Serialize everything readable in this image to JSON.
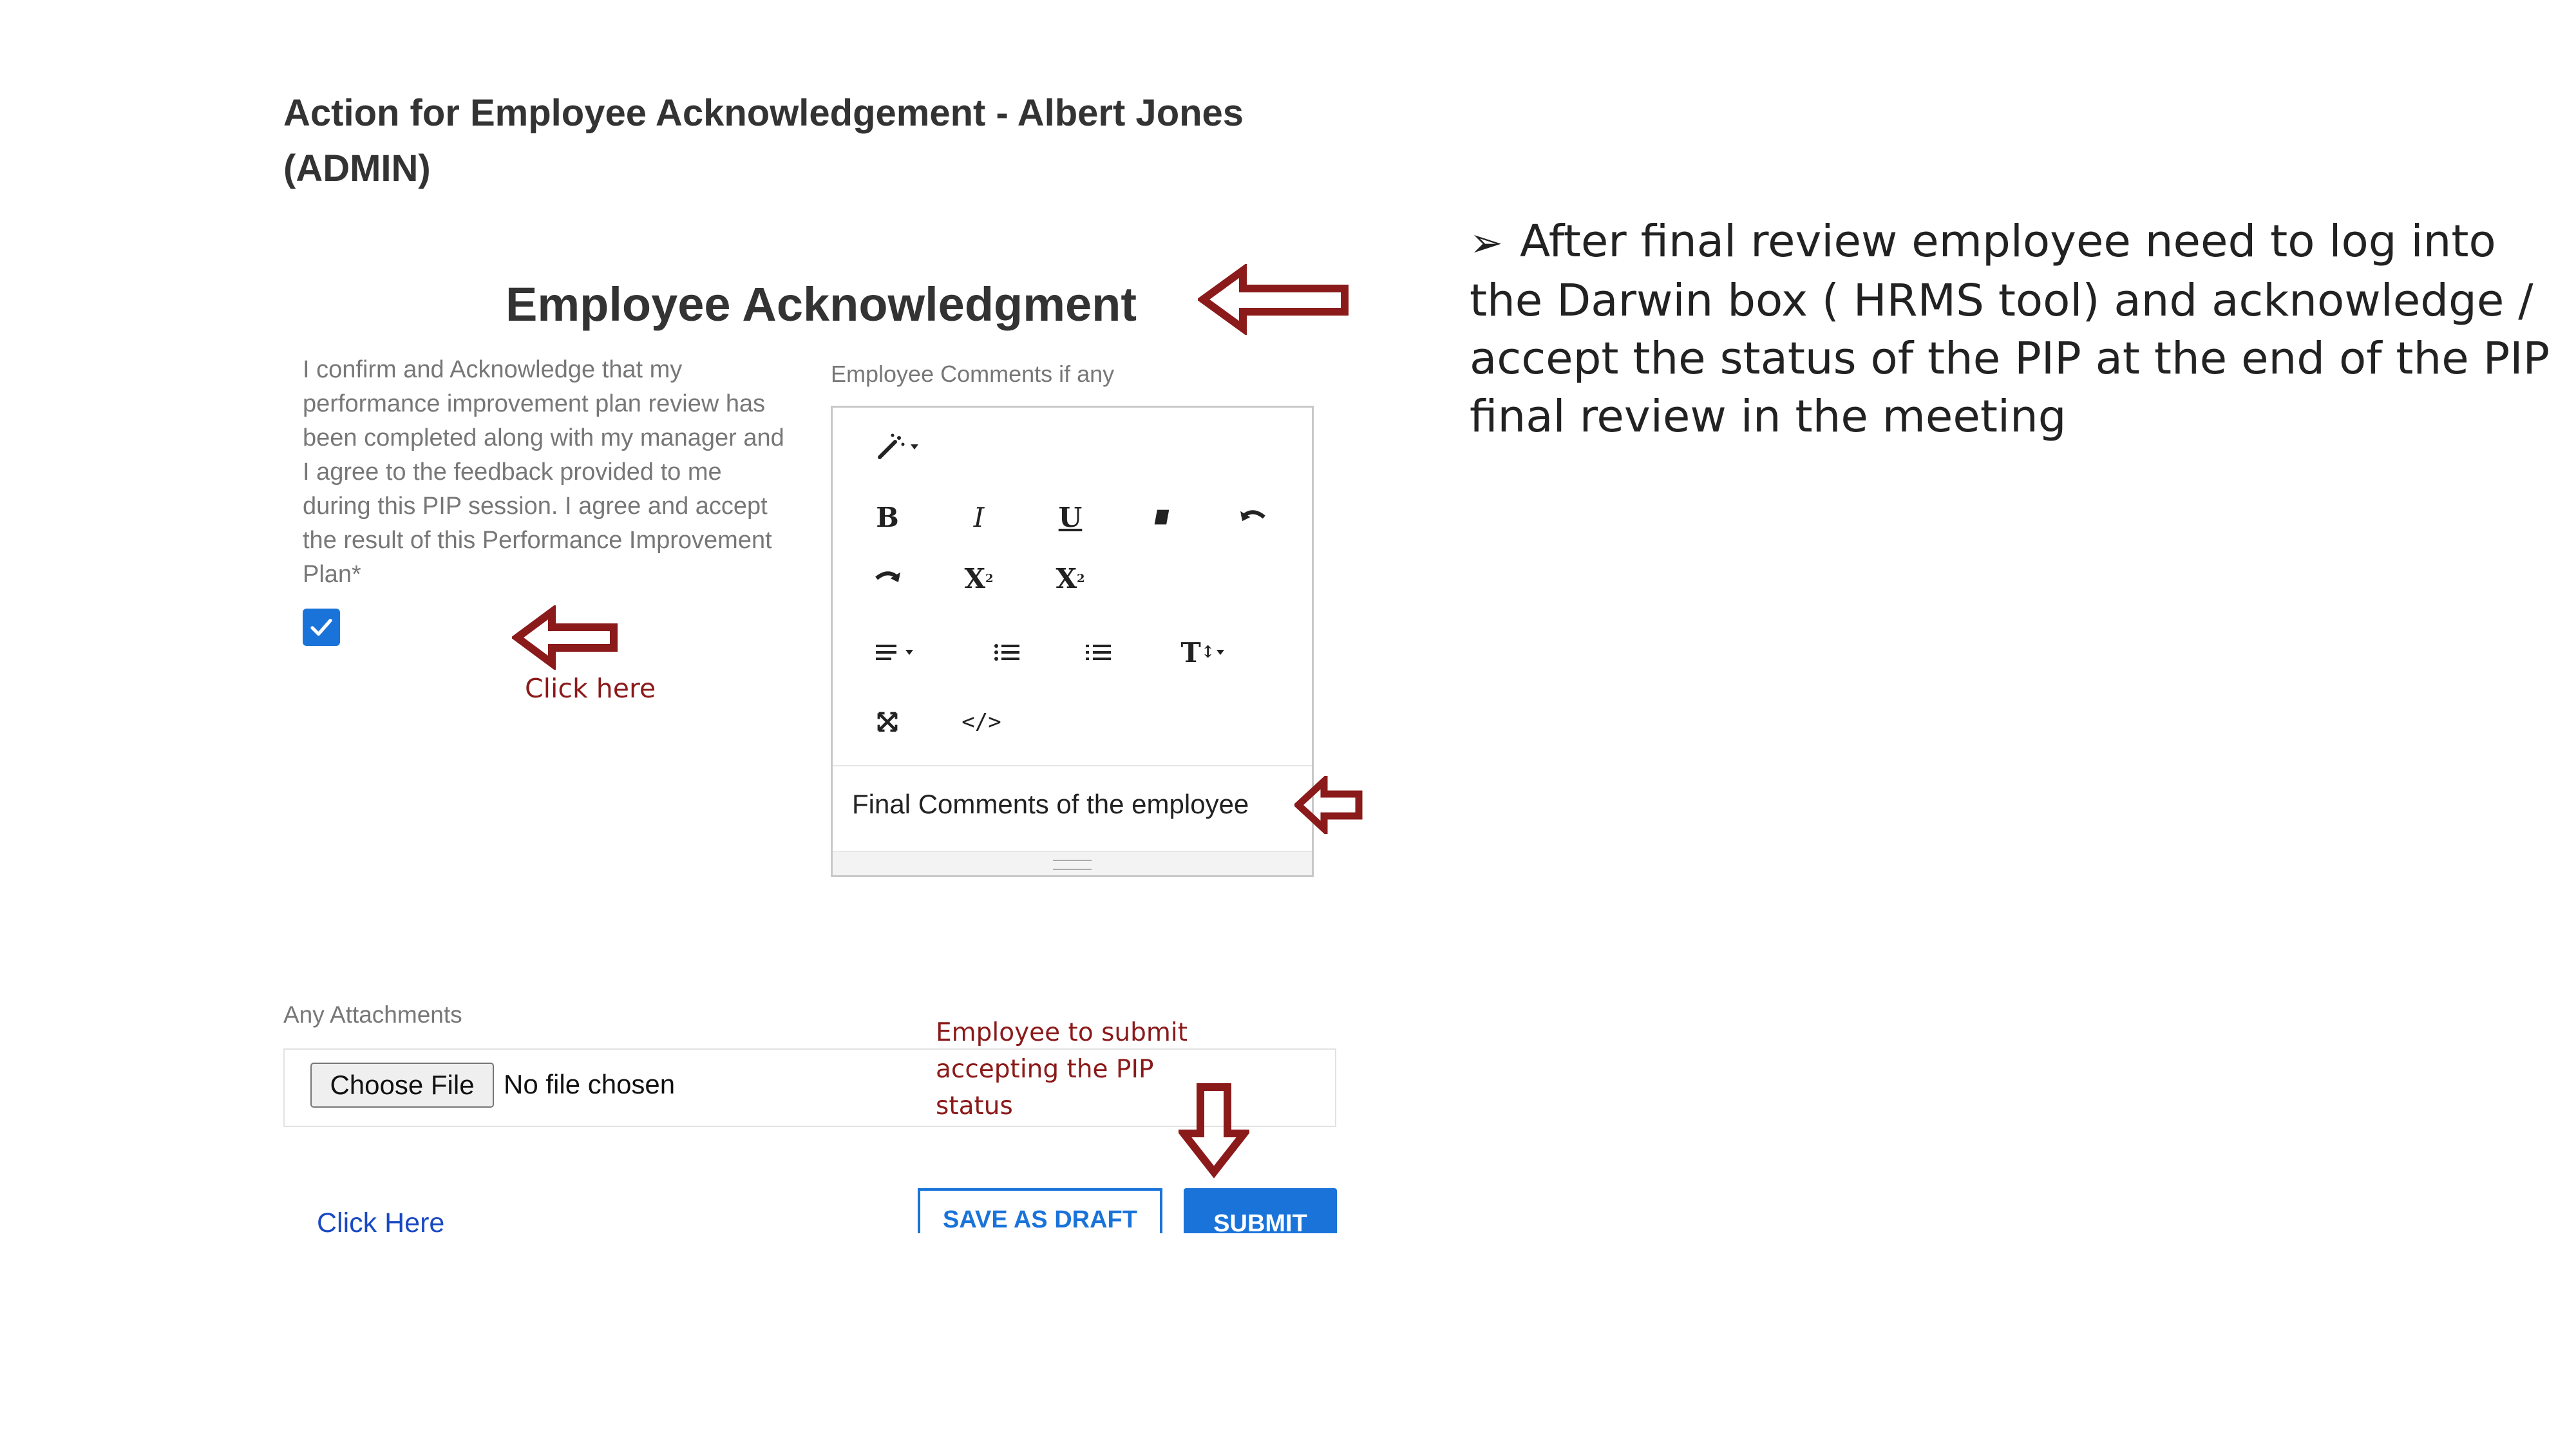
{
  "screenshot": {
    "page_title_line1": "Action for Employee Acknowledgement - Albert Jones",
    "page_title_line2": "(ADMIN)",
    "heading": "Employee Acknowledgment",
    "ack_text": "I confirm and Acknowledge that my performance improvement plan review has been completed along with my manager and I agree to the feedback provided to me during this PIP session. I agree and accept the result of this Performance Improvement Plan*",
    "ack_checked": true,
    "comments_label": "Employee Comments if any",
    "editor": {
      "toolbar": [
        {
          "name": "magic-wand-icon"
        },
        {
          "name": "bold-button",
          "glyph": "B"
        },
        {
          "name": "italic-button",
          "glyph": "I"
        },
        {
          "name": "underline-button",
          "glyph": "U"
        },
        {
          "name": "eraser-icon"
        },
        {
          "name": "undo-icon"
        },
        {
          "name": "redo-icon"
        },
        {
          "name": "superscript-button",
          "glyph": "X"
        },
        {
          "name": "subscript-button",
          "glyph": "X"
        },
        {
          "name": "align-dropdown-icon"
        },
        {
          "name": "unordered-list-icon"
        },
        {
          "name": "ordered-list-icon"
        },
        {
          "name": "font-size-dropdown-icon",
          "glyph": "T"
        },
        {
          "name": "fullscreen-icon"
        },
        {
          "name": "code-view-icon",
          "glyph": "</>"
        }
      ],
      "content": "Final Comments of the employee"
    },
    "attachments_label": "Any Attachments",
    "choose_file_label": "Choose File",
    "no_file_text": "No file chosen",
    "click_here_link": "Click Here",
    "save_draft_label": "SAVE AS DRAFT",
    "submit_label": "SUBMIT"
  },
  "annotations": {
    "click_here": "Click here",
    "employee_submit": "Employee to submit accepting the PIP status",
    "arrow_color": "#8b1a1a"
  },
  "bullet_text": "After final review employee need to log into the Darwin box ( HRMS tool) and acknowledge / accept the status of the PIP at the end of the PIP final review in the meeting",
  "colors": {
    "primary": "#1a73d9",
    "annotation": "#8b1a1a"
  }
}
